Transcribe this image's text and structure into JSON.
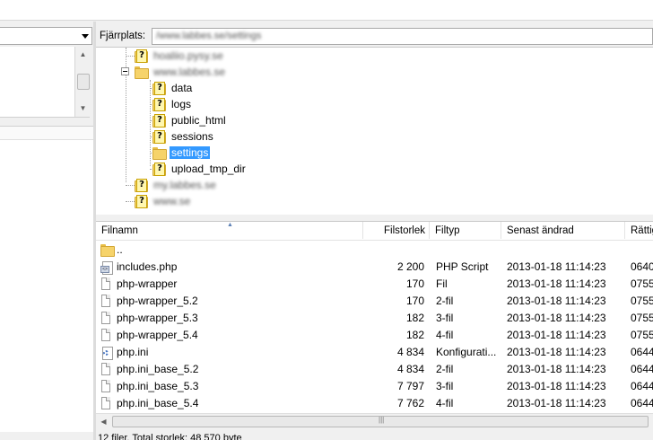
{
  "local_panel": {
    "top_tree_items": [],
    "combo_arrow": "chevron-down-icon"
  },
  "remote_site": {
    "label": "Fjärrplats:",
    "path": "/www.labbes.se/settings"
  },
  "remote_tree": {
    "items": [
      {
        "label": "hoaliio.pysy.se",
        "blurred": true,
        "icon": "question-folder-icon"
      },
      {
        "label": "www.labbes.se",
        "blurred": true,
        "icon": "open-folder-icon"
      },
      {
        "label": "data",
        "icon": "question-folder-icon"
      },
      {
        "label": "logs",
        "icon": "question-folder-icon"
      },
      {
        "label": "public_html",
        "icon": "question-folder-icon"
      },
      {
        "label": "sessions",
        "icon": "question-folder-icon"
      },
      {
        "label": "settings",
        "icon": "folder-icon",
        "selected": true
      },
      {
        "label": "upload_tmp_dir",
        "icon": "question-folder-icon"
      },
      {
        "label": "my.labbes.se",
        "blurred": true,
        "icon": "question-folder-icon"
      },
      {
        "label": "www.se",
        "blurred": true,
        "icon": "question-folder-icon"
      }
    ]
  },
  "file_list": {
    "columns": [
      "Filnamn",
      "Filstorlek",
      "Filtyp",
      "Senast ändrad",
      "Rättig"
    ],
    "sort_icon": "sort-up-icon",
    "rows": [
      {
        "name": "..",
        "size": "",
        "type": "",
        "modified": "",
        "perm": "",
        "icon": "folder-icon"
      },
      {
        "name": "includes.php",
        "size": "2 200",
        "type": "PHP Script",
        "modified": "2013-01-18 11:14:23",
        "perm": "0640",
        "icon": "php-file-icon"
      },
      {
        "name": "php-wrapper",
        "size": "170",
        "type": "Fil",
        "modified": "2013-01-18 11:14:23",
        "perm": "0755",
        "icon": "file-icon"
      },
      {
        "name": "php-wrapper_5.2",
        "size": "170",
        "type": "2-fil",
        "modified": "2013-01-18 11:14:23",
        "perm": "0755",
        "icon": "file-icon"
      },
      {
        "name": "php-wrapper_5.3",
        "size": "182",
        "type": "3-fil",
        "modified": "2013-01-18 11:14:23",
        "perm": "0755",
        "icon": "file-icon"
      },
      {
        "name": "php-wrapper_5.4",
        "size": "182",
        "type": "4-fil",
        "modified": "2013-01-18 11:14:23",
        "perm": "0755",
        "icon": "file-icon"
      },
      {
        "name": "php.ini",
        "size": "4 834",
        "type": "Konfigurati...",
        "modified": "2013-01-18 11:14:23",
        "perm": "0644",
        "icon": "config-file-icon"
      },
      {
        "name": "php.ini_base_5.2",
        "size": "4 834",
        "type": "2-fil",
        "modified": "2013-01-18 11:14:23",
        "perm": "0644",
        "icon": "file-icon"
      },
      {
        "name": "php.ini_base_5.3",
        "size": "7 797",
        "type": "3-fil",
        "modified": "2013-01-18 11:14:23",
        "perm": "0644",
        "icon": "file-icon"
      },
      {
        "name": "php.ini_base_5.4",
        "size": "7 762",
        "type": "4-fil",
        "modified": "2013-01-18 11:14:23",
        "perm": "0644",
        "icon": "file-icon"
      }
    ]
  },
  "status_bar": {
    "text": "12 filer. Total storlek: 48 570 byte"
  },
  "colors": {
    "selection": "#3399ff",
    "panel_bg": "#f0f0f0",
    "list_bg": "#ffffff"
  }
}
